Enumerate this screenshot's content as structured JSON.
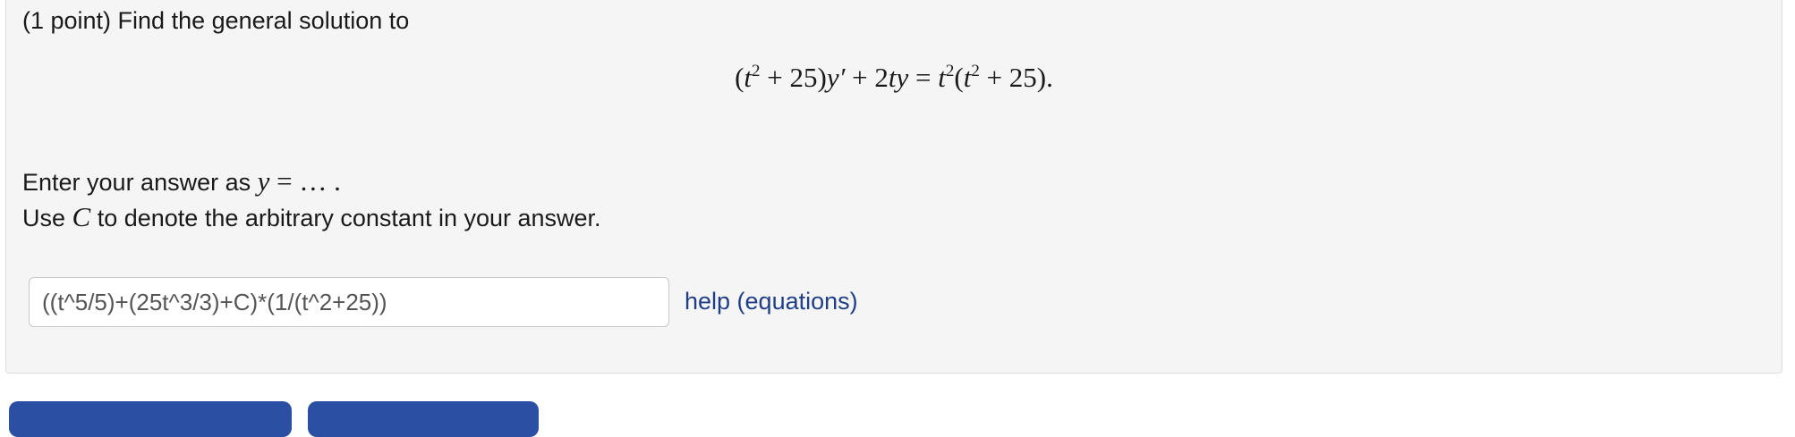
{
  "problem": {
    "prompt": "(1 point) Find the general solution to",
    "equation": {
      "lhs_open": "(",
      "var_t": "t",
      "exp_2": "2",
      "plus_25_close": " + 25)",
      "var_y_prime": "y′",
      "plus": " + 2",
      "var_ty": "ty",
      "equals": " = ",
      "rhs_open": "(",
      "rhs_close": " + 25)."
    },
    "instruction_1_text": "Enter your answer as ",
    "instruction_1_math": "y",
    "instruction_1_tail": " = … .",
    "instruction_2_prefix": "Use ",
    "instruction_2_math": "C",
    "instruction_2_suffix": " to denote the arbitrary constant in your answer."
  },
  "answer": {
    "value": "((t^5/5)+(25t^3/3)+C)*(1/(t^2+25))"
  },
  "help": {
    "label": "help (equations)"
  },
  "colors": {
    "panel_background": "#f5f5f5",
    "link": "#1f3f8a",
    "button": "#2a4fa3"
  }
}
